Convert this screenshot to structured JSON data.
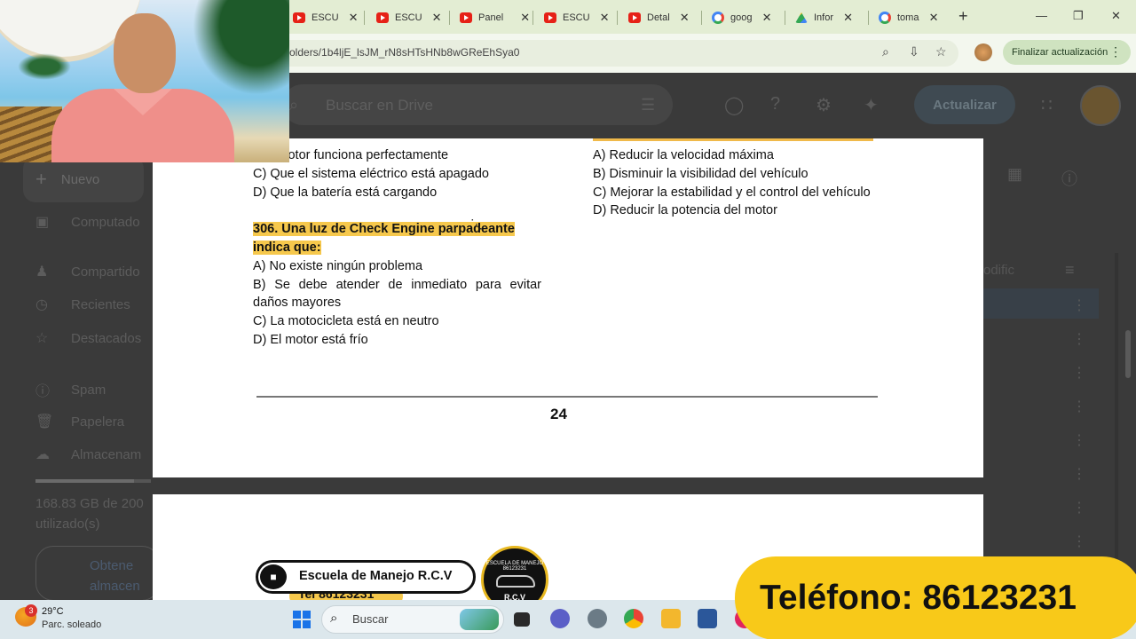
{
  "browser": {
    "tabs": [
      {
        "label": "ESCU",
        "icon": "youtube-icon"
      },
      {
        "label": "ESCU",
        "icon": "youtube-icon"
      },
      {
        "label": "Panel",
        "icon": "youtube-icon"
      },
      {
        "label": "ESCU",
        "icon": "youtube-icon"
      },
      {
        "label": "Detal",
        "icon": "youtube-icon"
      },
      {
        "label": "goog",
        "icon": "google-icon"
      },
      {
        "label": "Infor",
        "icon": "drive-icon"
      },
      {
        "label": "toma",
        "icon": "google-icon"
      }
    ],
    "url": "olders/1b4ljE_lsJM_rN8sHTsHNb8wGReEhSya0",
    "update_button": "Finalizar actualización"
  },
  "drive": {
    "search_placeholder": "Buscar en Drive",
    "update_button": "Actualizar",
    "new_button": "Nuevo",
    "nav": [
      "Computado",
      "Compartido",
      "Recientes",
      "Destacados",
      "Spam",
      "Papelera",
      "Almacenam"
    ],
    "storage_text": "168.83 GB de 200 utilizado(s)",
    "obtain_text": "Obtene almacen",
    "column_header": "odific"
  },
  "document": {
    "left_lines": [
      {
        "text": "   e el motor funciona perfectamente"
      },
      {
        "text": "C) Que el sistema eléctrico está apagado"
      },
      {
        "text": "D) Que la batería está cargando"
      }
    ],
    "question": "306. Una luz de Check Engine parpadeante indica que:",
    "answers": [
      "A) No existe ningún problema",
      "B) Se debe atender de inmediato para evitar daños mayores",
      "C) La motocicleta está en neutro",
      "D) El motor está frío"
    ],
    "right_answers": [
      "A) Reducir la velocidad máxima",
      "B) Disminuir la visibilidad del vehículo",
      "C) Mejorar la estabilidad y el control del vehículo",
      "D) Reducir la potencia del motor"
    ],
    "page_number": "24",
    "school_name": "Escuela de Manejo R.C.V",
    "school_tel": "Tel 86123231",
    "logo_top": "ESCUELA DE MANEJO 86123231",
    "logo_bottom": "R.C.V"
  },
  "taskbar": {
    "weather_badge": "3",
    "temperature": "29°C",
    "weather_desc": "Parc. soleado",
    "search_label": "Buscar"
  },
  "banner": {
    "phone_text": "Teléfono: 86123231"
  }
}
